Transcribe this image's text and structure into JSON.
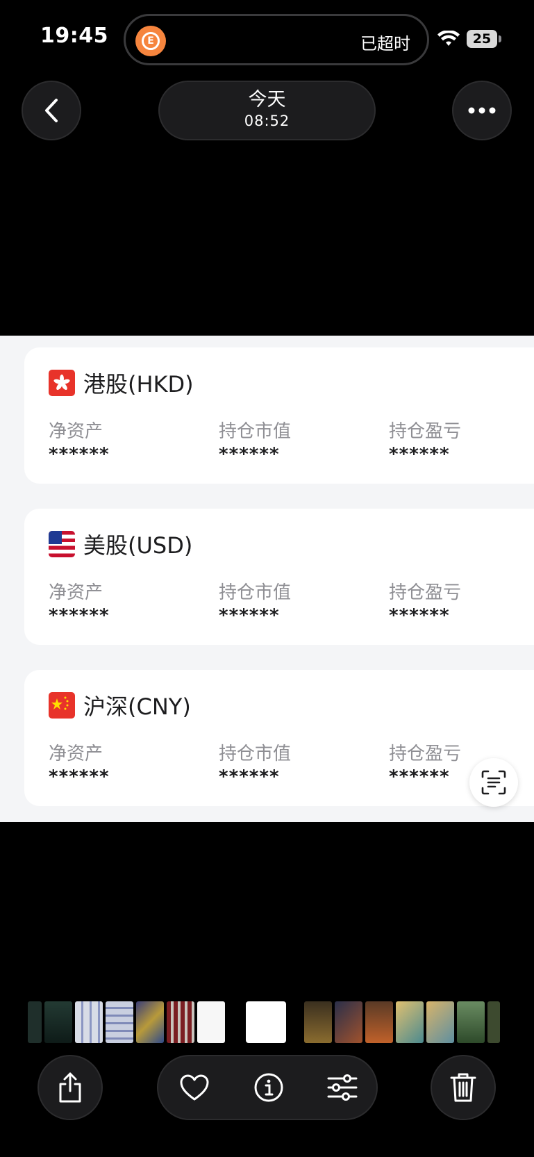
{
  "status_bar": {
    "time": "19:45",
    "activity_label": "已超时",
    "battery": "25",
    "app_icon_glyph": "E"
  },
  "nav": {
    "date_label": "今天",
    "time_label": "08:52"
  },
  "markets": [
    {
      "name": "港股(HKD)",
      "flag": "hong-kong-flag",
      "metrics": [
        {
          "label": "净资产",
          "value": "******"
        },
        {
          "label": "持仓市值",
          "value": "******"
        },
        {
          "label": "持仓盈亏",
          "value": "******"
        }
      ]
    },
    {
      "name": "美股(USD)",
      "flag": "us-flag",
      "metrics": [
        {
          "label": "净资产",
          "value": "******"
        },
        {
          "label": "持仓市值",
          "value": "******"
        },
        {
          "label": "持仓盈亏",
          "value": "******"
        }
      ]
    },
    {
      "name": "沪深(CNY)",
      "flag": "china-flag",
      "metrics": [
        {
          "label": "净资产",
          "value": "******"
        },
        {
          "label": "持仓市值",
          "value": "******"
        },
        {
          "label": "持仓盈亏",
          "value": "******"
        }
      ]
    }
  ],
  "colors": {
    "accent_orange": "#f6853e",
    "flag_red": "#e8332a",
    "page_bg": "#f4f5f7"
  },
  "toolbar": {
    "icons": [
      "share-icon",
      "heart-icon",
      "info-icon",
      "adjust-icon",
      "trash-icon"
    ]
  }
}
